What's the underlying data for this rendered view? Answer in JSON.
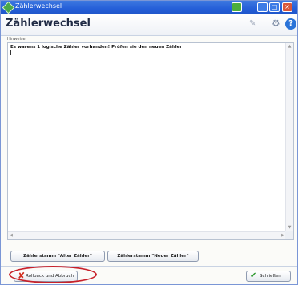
{
  "window": {
    "title": "Zählerwechsel",
    "heading": "Zählerwechsel",
    "field_label": "Hinweise",
    "message": "Es warens 1 logische Zähler vorhanden! Prüfen sie den neuen Zähler",
    "buttons": {
      "alter": "Zählerstamm \"Alter Zähler\"",
      "neuer": "Zählerstamm \"Neuer Zähler\"",
      "rollback": "Rollback und Abbruch",
      "close": "Schließen"
    },
    "icons": [
      "app-icon",
      "pencil-icon",
      "gear-icon",
      "help-icon",
      "x-icon",
      "check-icon"
    ],
    "colors": {
      "titlebar": "#245ed8",
      "annotation": "#c8212a",
      "accent_red": "#d12a1a",
      "accent_green": "#2e9a2e"
    }
  }
}
